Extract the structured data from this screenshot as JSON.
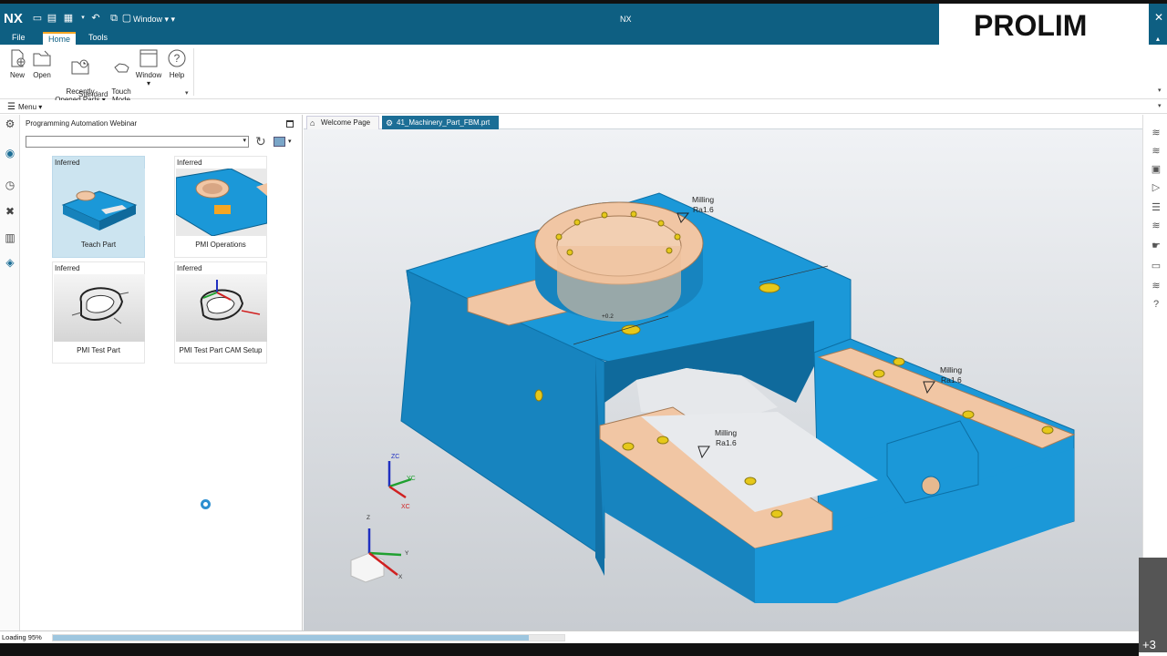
{
  "app": {
    "logo": "NX",
    "title": "NX",
    "window_menu": "Window"
  },
  "brand": {
    "name": "PROLIM"
  },
  "ribbon_tabs": [
    {
      "label": "File"
    },
    {
      "label": "Home"
    },
    {
      "label": "Tools"
    }
  ],
  "ribbon": {
    "buttons": [
      {
        "label": "New",
        "icon": "new-file-icon"
      },
      {
        "label": "Open",
        "icon": "folder-open-icon"
      },
      {
        "label": "Recently\nOpened Parts",
        "icon": "recent-parts-icon"
      },
      {
        "label": "Touch\nMode",
        "icon": "touch-hand-icon"
      },
      {
        "label": "Window",
        "icon": "window-icon"
      },
      {
        "label": "Help",
        "icon": "help-icon"
      }
    ],
    "group_label": "Standard"
  },
  "menubar": {
    "label": "Menu"
  },
  "navigator": {
    "title": "Programming Automation Webinar",
    "select_value": "",
    "cards": [
      {
        "tag": "Inferred",
        "name": "Teach Part",
        "selected": true
      },
      {
        "tag": "Inferred",
        "name": "PMI Operations",
        "selected": false
      },
      {
        "tag": "Inferred",
        "name": "PMI Test Part",
        "selected": false
      },
      {
        "tag": "Inferred",
        "name": "PMI Test Part CAM Setup",
        "selected": false
      }
    ]
  },
  "graphics_tabs": [
    {
      "label": "Welcome Page",
      "active": false
    },
    {
      "label": "41_Machinery_Part_FBM.prt",
      "active": true
    }
  ],
  "model": {
    "annotations": [
      {
        "line1": "Milling",
        "line2": "Ra1.6"
      },
      {
        "line1": "Milling",
        "line2": "Ra1.6"
      },
      {
        "line1": "Milling",
        "line2": "Ra1.6"
      }
    ],
    "dimension": "+0.2",
    "wcs_labels": {
      "zc": "ZC",
      "yc": "YC",
      "xc": "XC"
    },
    "triad_labels": {
      "z": "Z",
      "y": "Y",
      "x": "X"
    },
    "colors": {
      "body": "#1b98d8",
      "face": "#f1c6a4",
      "hole": "#e6c81a"
    }
  },
  "status": {
    "text": "Loading 95%",
    "progress": 0.95
  },
  "overflow_badge": "+3"
}
